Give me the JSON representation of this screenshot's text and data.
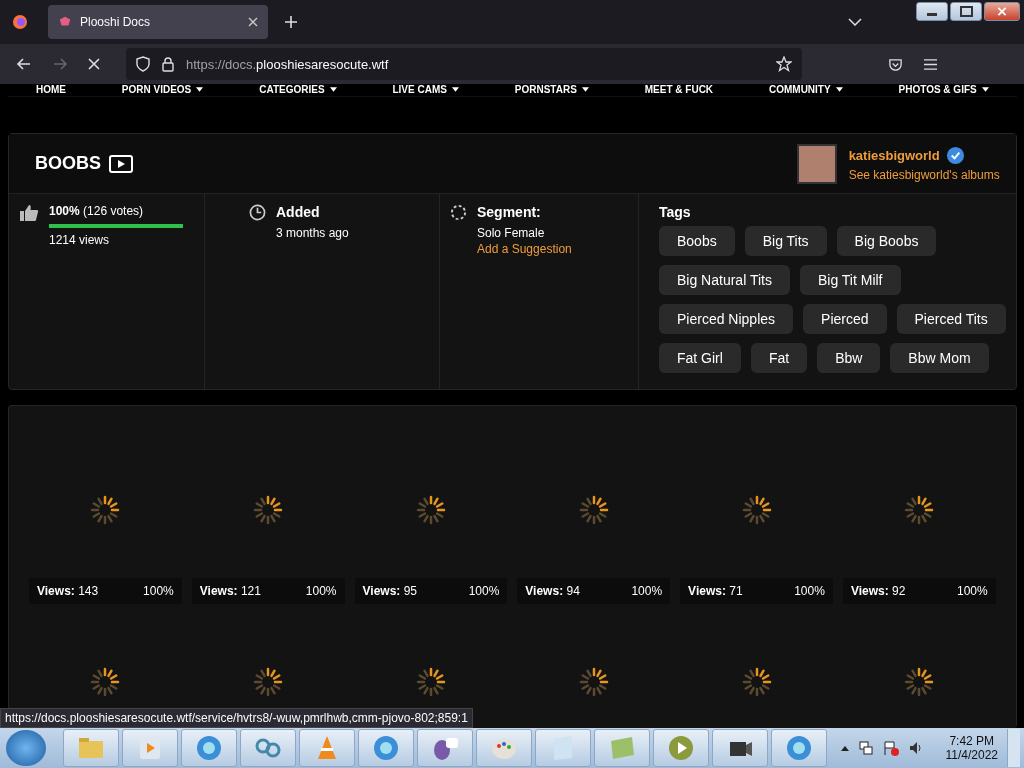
{
  "browser": {
    "tab_title": "Plooshi Docs",
    "url_prefix": "https://docs.",
    "url_domain": "plooshiesaresocute.wtf",
    "loading": true
  },
  "nav": [
    {
      "label": "HOME",
      "dropdown": false
    },
    {
      "label": "PORN VIDEOS",
      "dropdown": true
    },
    {
      "label": "CATEGORIES",
      "dropdown": true
    },
    {
      "label": "LIVE CAMS",
      "dropdown": true
    },
    {
      "label": "PORNSTARS",
      "dropdown": true
    },
    {
      "label": "MEET & FUCK",
      "dropdown": false
    },
    {
      "label": "COMMUNITY",
      "dropdown": true
    },
    {
      "label": "PHOTOS & GIFS",
      "dropdown": true
    }
  ],
  "album": {
    "title": "BOOBS",
    "uploader": "katiesbigworld",
    "verified": true,
    "albums_link": "See katiesbigworld's albums"
  },
  "rating": {
    "percent": "100%",
    "votes": "(126 votes)",
    "level": 1.0,
    "views": "1214 views"
  },
  "added": {
    "label": "Added",
    "value": "3 months ago"
  },
  "segment": {
    "label": "Segment:",
    "value": "Solo Female",
    "suggest_link": "Add a Suggestion"
  },
  "tags": {
    "label": "Tags",
    "items": [
      "Boobs",
      "Big Tits",
      "Big Boobs",
      "Big Natural Tits",
      "Big Tit Milf",
      "Pierced Nipples",
      "Pierced",
      "Pierced Tits",
      "Fat Girl",
      "Fat",
      "Bbw",
      "Bbw Mom"
    ]
  },
  "photos": [
    {
      "views_label": "Views:",
      "views": "143",
      "rating": "100%"
    },
    {
      "views_label": "Views:",
      "views": "121",
      "rating": "100%"
    },
    {
      "views_label": "Views:",
      "views": "95",
      "rating": "100%"
    },
    {
      "views_label": "Views:",
      "views": "94",
      "rating": "100%"
    },
    {
      "views_label": "Views:",
      "views": "71",
      "rating": "100%"
    },
    {
      "views_label": "Views:",
      "views": "92",
      "rating": "100%"
    }
  ],
  "status_url": "https://docs.plooshiesaresocute.wtf/service/hvtrs8/-wuw,pmrlhwb,cmm-pjovo-802;859:1",
  "taskbar": {
    "time": "7:42 PM",
    "date": "11/4/2022"
  }
}
